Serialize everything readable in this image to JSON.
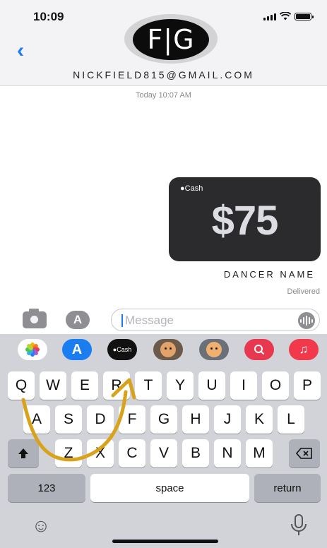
{
  "status_bar": {
    "time": "10:09"
  },
  "header": {
    "contact_name": "NICKFIELD815@GMAIL.COM",
    "avatar_monogram": "F|G",
    "back_icon": "chevron-left-icon"
  },
  "conversation": {
    "timestamp": "Today 10:07 AM",
    "cash_message": {
      "label": "Cash",
      "amount": "$75"
    },
    "caption": "DANCER NAME",
    "delivery_status": "Delivered"
  },
  "compose": {
    "placeholder": "Message",
    "value": ""
  },
  "app_strip": [
    {
      "name": "photos",
      "icon": "photos-icon",
      "label": ""
    },
    {
      "name": "app-store",
      "icon": "app-store-icon",
      "label": "A"
    },
    {
      "name": "apple-cash",
      "icon": "apple-cash-icon",
      "label": "Cash"
    },
    {
      "name": "memoji",
      "icon": "memoji-icon",
      "label": ""
    },
    {
      "name": "memoji-stickers",
      "icon": "memoji-stickers-icon",
      "label": ""
    },
    {
      "name": "web-search",
      "icon": "search-icon",
      "label": ""
    },
    {
      "name": "music",
      "icon": "music-icon",
      "label": "♫"
    }
  ],
  "keyboard": {
    "row1": [
      "Q",
      "W",
      "E",
      "R",
      "T",
      "Y",
      "U",
      "I",
      "O",
      "P"
    ],
    "row2": [
      "A",
      "S",
      "D",
      "F",
      "G",
      "H",
      "J",
      "K",
      "L"
    ],
    "row3": [
      "Z",
      "X",
      "C",
      "V",
      "B",
      "N",
      "M"
    ],
    "numbers_label": "123",
    "space_label": "space",
    "return_label": "return"
  },
  "colors": {
    "accent": "#1a7cf5",
    "cash_bubble": "#2b2b2d",
    "keyboard_bg": "#d2d3d8",
    "gesture_stroke": "#d8a21b"
  }
}
